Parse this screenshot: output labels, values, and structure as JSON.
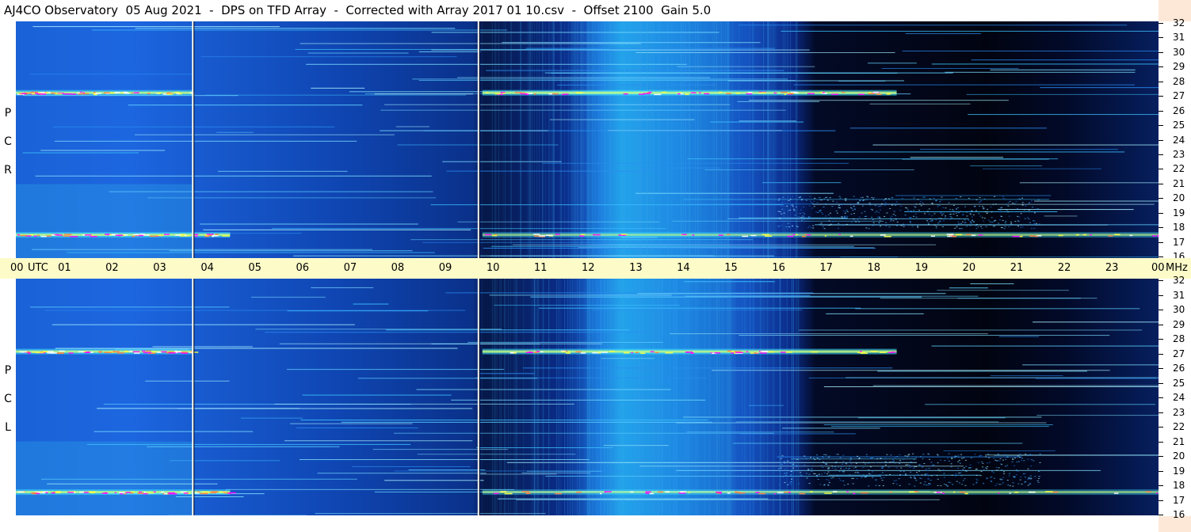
{
  "title": "AJ4CO Observatory  05 Aug 2021  -  DPS on TFD Array  -  Corrected with Array 2017 01 10.csv  -  Offset 2100  Gain 5.0",
  "panels": [
    {
      "name": "rcp",
      "label_letters": [
        "P",
        "C",
        "R"
      ]
    },
    {
      "name": "lcp",
      "label_letters": [
        "P",
        "C",
        "L"
      ]
    }
  ],
  "time_axis": {
    "utc_label": "UTC",
    "mhz_label": "MHz",
    "hour_labels": [
      "00",
      "01",
      "02",
      "03",
      "04",
      "05",
      "06",
      "07",
      "08",
      "09",
      "10",
      "11",
      "12",
      "13",
      "14",
      "15",
      "16",
      "17",
      "18",
      "19",
      "20",
      "21",
      "22",
      "23",
      "00"
    ]
  },
  "freq_axis": {
    "labels": [
      "32",
      "31",
      "30",
      "29",
      "28",
      "27",
      "26",
      "25",
      "24",
      "23",
      "22",
      "21",
      "20",
      "19",
      "18",
      "17",
      "16"
    ]
  },
  "chart_data": [
    {
      "type": "heatmap",
      "panel": "RCP",
      "x_axis": {
        "range_hours_utc": [
          0,
          24
        ],
        "tick_labels": [
          "00",
          "01",
          "02",
          "03",
          "04",
          "05",
          "06",
          "07",
          "08",
          "09",
          "10",
          "11",
          "12",
          "13",
          "14",
          "15",
          "16",
          "17",
          "18",
          "19",
          "20",
          "21",
          "22",
          "23",
          "00"
        ]
      },
      "y_axis": {
        "unit": "MHz",
        "range": [
          16,
          32
        ],
        "tick_labels": [
          "16",
          "17",
          "18",
          "19",
          "20",
          "21",
          "22",
          "23",
          "24",
          "25",
          "26",
          "27",
          "28",
          "29",
          "30",
          "31",
          "32"
        ]
      },
      "colors": {
        "low": "#000000",
        "mid": "#1a62d6",
        "high": "#ff00ff"
      },
      "features": {
        "bright_bands_mhz": [
          27.2,
          17.6
        ],
        "vertical_markers_utc": [
          3.7,
          9.7
        ]
      }
    },
    {
      "type": "heatmap",
      "panel": "LCP",
      "x_axis": {
        "range_hours_utc": [
          0,
          24
        ],
        "tick_labels": [
          "00",
          "01",
          "02",
          "03",
          "04",
          "05",
          "06",
          "07",
          "08",
          "09",
          "10",
          "11",
          "12",
          "13",
          "14",
          "15",
          "16",
          "17",
          "18",
          "19",
          "20",
          "21",
          "22",
          "23",
          "00"
        ]
      },
      "y_axis": {
        "unit": "MHz",
        "range": [
          16,
          32
        ],
        "tick_labels": [
          "16",
          "17",
          "18",
          "19",
          "20",
          "21",
          "22",
          "23",
          "24",
          "25",
          "26",
          "27",
          "28",
          "29",
          "30",
          "31",
          "32"
        ]
      },
      "colors": {
        "low": "#000000",
        "mid": "#1a62d6",
        "high": "#ff00ff"
      },
      "features": {
        "bright_bands_mhz": [
          27.1,
          17.6
        ],
        "vertical_markers_utc": [
          3.7,
          9.7
        ]
      }
    }
  ]
}
